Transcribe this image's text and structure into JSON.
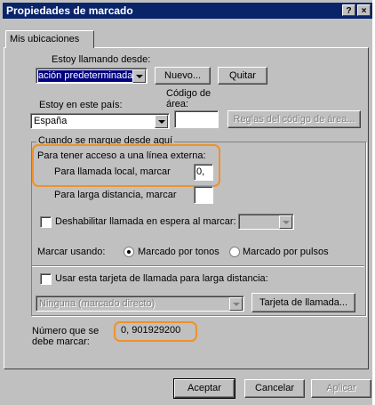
{
  "window": {
    "title": "Propiedades de marcado",
    "help_btn": "?",
    "close_btn": "×"
  },
  "tab": {
    "label": "Mis ubicaciones"
  },
  "location": {
    "label": "Estoy llamando desde:",
    "value": "ación predeterminada",
    "new_button": "Nuevo...",
    "remove_button": "Quitar"
  },
  "country": {
    "label": "Estoy en este país:",
    "value": "España",
    "area_code_label_1": "Código de",
    "area_code_label_2": "área:",
    "area_code_value": "",
    "area_rules_button": "Reglas del código de área..."
  },
  "dialing_group": {
    "title": "Cuando se marque desde aquí",
    "outside_line_label": "Para tener acceso a una línea externa:",
    "local_label": "Para llamada local, marcar",
    "local_value": "0,",
    "long_distance_label": "Para larga distancia, marcar",
    "long_distance_value": "",
    "call_waiting_label": "Deshabilitar llamada en espera al marcar:",
    "call_waiting_value": "",
    "dial_using_label": "Marcar usando:",
    "tone_label": "Marcado por tonos",
    "pulse_label": "Marcado por pulsos",
    "calling_card_label": "Usar esta tarjeta de llamada para larga distancia:",
    "calling_card_value": "Ninguna (marcado directo)",
    "calling_card_button": "Tarjeta de llamada..."
  },
  "number": {
    "label_1": "Número que se",
    "label_2": "debe marcar:",
    "value": "0, 901929200"
  },
  "footer": {
    "accept": "Aceptar",
    "cancel": "Cancelar",
    "apply": "Aplicar"
  },
  "colors": {
    "highlight": "#f0912a",
    "titlebar": "#0a246a",
    "face": "#c0c0c0",
    "selection": "#000080"
  }
}
